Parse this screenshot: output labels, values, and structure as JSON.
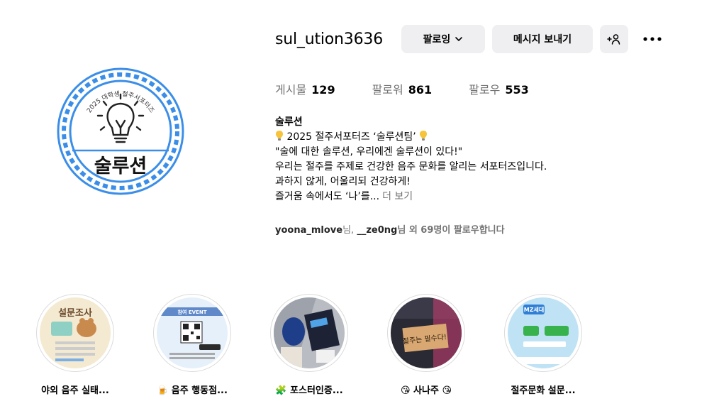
{
  "profile": {
    "username": "sul_ution3636",
    "follow_label": "팔로잉",
    "message_label": "메시지 보내기",
    "avatar": {
      "arc_text": "2025 대학생 절주서포터즈",
      "name": "술루션"
    }
  },
  "stats": [
    {
      "label": "게시물",
      "value": "129"
    },
    {
      "label": "팔로워",
      "value": "861"
    },
    {
      "label": "팔로우",
      "value": "553"
    }
  ],
  "bio": {
    "name": "술루션",
    "line1": "2025 절주서포터즈 ‘술루션팀’",
    "line2": "\"술에 대한 솔루션, 우리에겐 술루션이 있다!\"",
    "line3": "우리는 절주를 주제로 건강한 음주 문화를 알리는 서포터즈입니다.",
    "line4": "과하지 않게, 어울리되 건강하게!",
    "line5": "즐거움 속에서도 ‘나’를...",
    "more": "더 보기"
  },
  "followed_by": {
    "user1": "yoona_mlove",
    "suffix1": "님, ",
    "user2": "__ze0ng",
    "suffix2": "님 외 69명이 팔로우합니다"
  },
  "highlights": [
    {
      "label": "야외 음주 실태...",
      "image_text": "설문조사"
    },
    {
      "label": "🍺 음주 행동점...",
      "image_text": "참여 EVENT"
    },
    {
      "label": "🧩 포스터인증...",
      "image_text": ""
    },
    {
      "label": "😘 사나주 😘",
      "image_text": "절주는 필수다!"
    },
    {
      "label": "절주문화 설문...",
      "image_text": "MZ세대"
    }
  ],
  "colors": {
    "accent_blue": "#3b8ee8",
    "button_bg": "#efeff1",
    "secondary_text": "#737373"
  }
}
